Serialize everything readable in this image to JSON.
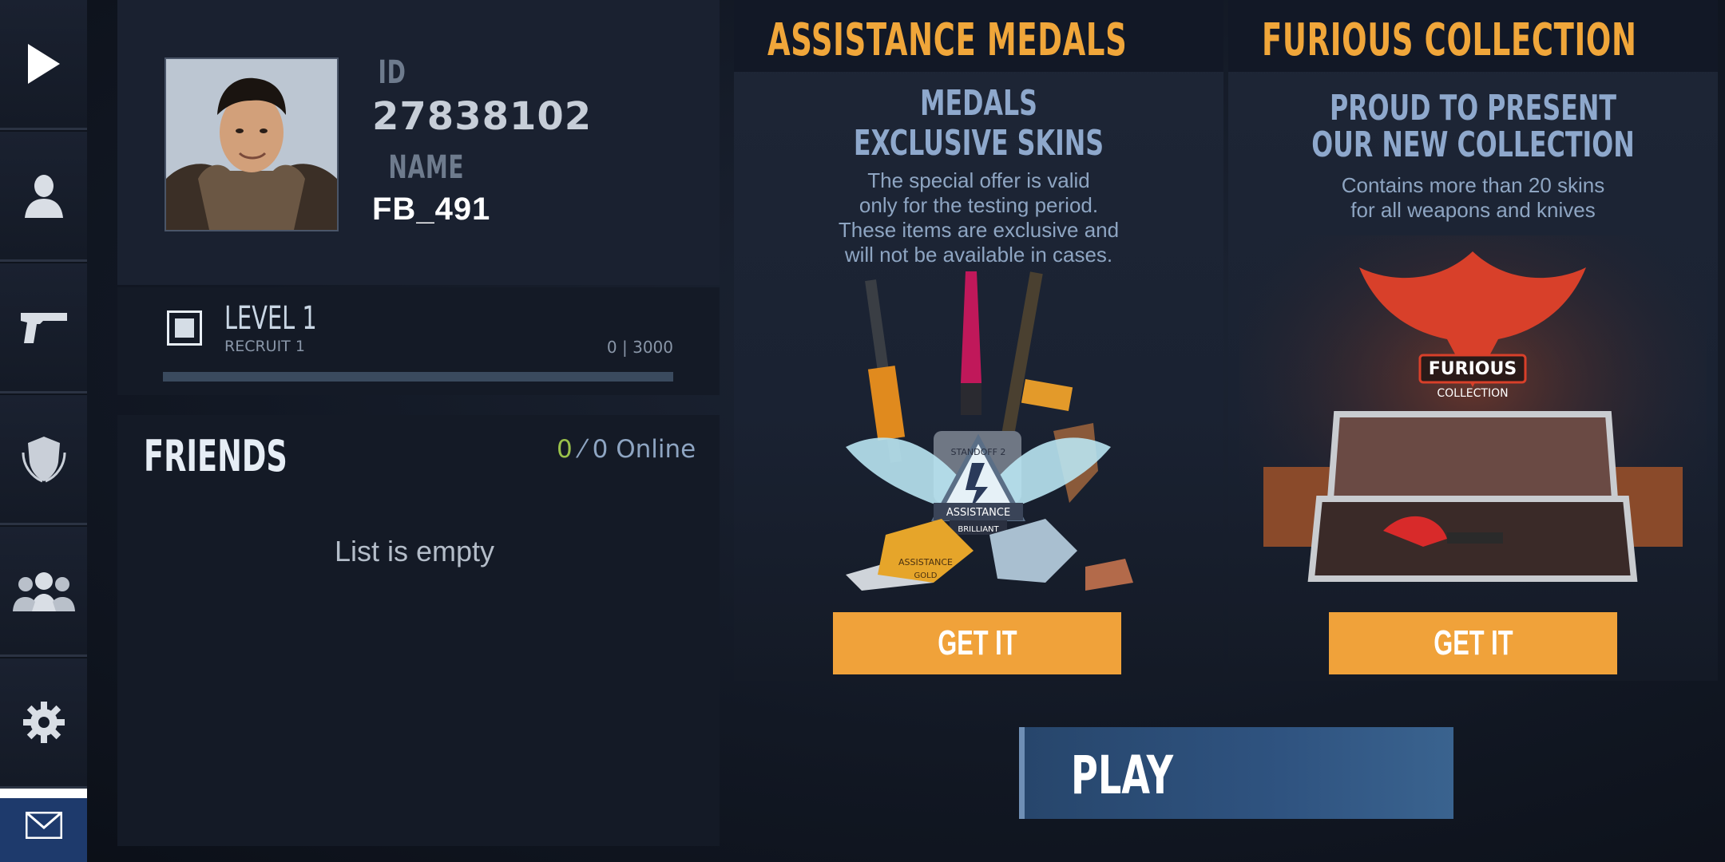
{
  "sidebar": {
    "items": [
      {
        "icon": "play-icon"
      },
      {
        "icon": "user-icon"
      },
      {
        "icon": "pistol-icon"
      },
      {
        "icon": "shield-icon"
      },
      {
        "icon": "group-icon"
      },
      {
        "icon": "gear-icon"
      },
      {
        "icon": "mail-icon"
      }
    ]
  },
  "profile": {
    "id_label": "ID",
    "id_value": "27838102",
    "name_label": "NAME",
    "name_value": "FB_491",
    "level_title": "LEVEL 1",
    "level_rank": "RECRUIT 1",
    "xp_text": "0 | 3000",
    "xp_progress": 0
  },
  "friends": {
    "title": "FRIENDS",
    "online_count": "0",
    "online_suffix": " ⁄ 0 Online",
    "empty_text": "List is empty"
  },
  "offers": [
    {
      "title": "ASSISTANCE MEDALS",
      "headline_1": "MEDALS",
      "headline_2": "EXCLUSIVE SKINS",
      "desc_1": "The special offer is valid",
      "desc_2": "only for the testing period.",
      "desc_3": "These items are exclusive and",
      "desc_4": "will not be available in cases.",
      "button": "GET IT",
      "art_text_1": "ASSISTANCE",
      "art_text_2": "BRILLIANT",
      "art_text_3": "STANDOFF 2",
      "art_text_4": "ASSISTANCE",
      "art_text_5": "GOLD"
    },
    {
      "title": "FURIOUS COLLECTION",
      "headline_1": "PROUD TO PRESENT",
      "headline_2": "OUR NEW COLLECTION",
      "desc_1": "Contains more than 20 skins",
      "desc_2": "for all weapons and knives",
      "button": "GET IT",
      "art_text_1": "FURIOUS",
      "art_text_2": "COLLECTION"
    }
  ],
  "play_button": "PLAY",
  "colors": {
    "accent_orange": "#f0a23a",
    "title_orange": "#f0a63a",
    "online_green": "#9ac24a",
    "play_blue": "#2f5380",
    "mail_blue": "#1e3a6c"
  }
}
